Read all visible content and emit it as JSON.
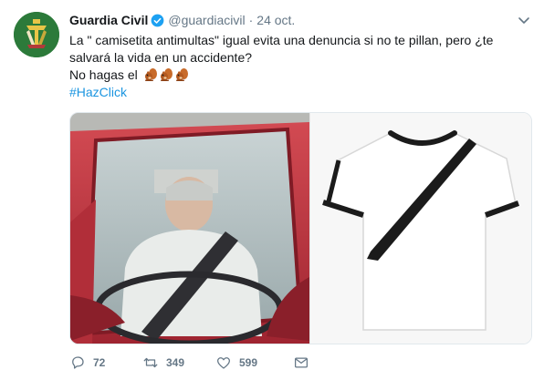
{
  "tweet": {
    "author_name": "Guardia Civil",
    "author_handle": "@guardiacivil",
    "separator": "·",
    "timestamp": "24 oct.",
    "text_line1": "La \" camisetita antimultas\" igual evita una denuncia si no te pillan, pero ¿te",
    "text_line2": "salvará la vida en un accidente?",
    "text_line3": "No hagas el",
    "emoji_name": "chipmunk-emoji",
    "emoji_count": 3,
    "hashtag": "#HazClick",
    "media": {
      "left_image": "driver-with-seatbelt-shirt-photo",
      "right_image": "white-tshirt-with-printed-seatbelt"
    }
  },
  "actions": {
    "reply": {
      "icon": "reply-icon",
      "count": "72"
    },
    "retweet": {
      "icon": "retweet-icon",
      "count": "349"
    },
    "like": {
      "icon": "heart-icon",
      "count": "599"
    },
    "message": {
      "icon": "envelope-icon"
    }
  },
  "colors": {
    "accent": "#1b95e0",
    "muted": "#657786",
    "verified": "#1da1f2",
    "avatar_bg": "#2c7a3a"
  }
}
